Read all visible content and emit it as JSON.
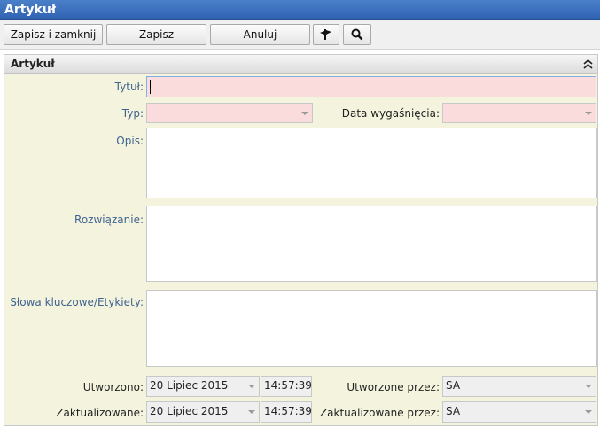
{
  "window": {
    "title": "Artykuł"
  },
  "toolbar": {
    "save_close_label": "Zapisz i zamknij",
    "save_label": "Zapisz",
    "cancel_label": "Anuluj"
  },
  "panel": {
    "title": "Artykuł"
  },
  "form": {
    "title_label": "Tytuł:",
    "title_value": "",
    "type_label": "Typ:",
    "type_value": "",
    "expiry_label": "Data wygaśnięcia:",
    "expiry_value": "",
    "description_label": "Opis:",
    "description_value": "",
    "solution_label": "Rozwiązanie:",
    "solution_value": "",
    "keywords_label": "Słowa kluczowe/Etykiety:",
    "keywords_value": "",
    "created_label": "Utworzono:",
    "created_date": "20 Lipiec 2015",
    "created_time": "14:57:39",
    "created_by_label": "Utworzone przez:",
    "created_by": "SA",
    "updated_label": "Zaktualizowane:",
    "updated_date": "20 Lipiec 2015",
    "updated_time": "14:57:39",
    "updated_by_label": "Zaktualizowane przez:",
    "updated_by": "SA"
  },
  "colors": {
    "titlebar": "#2f63b2",
    "required_field": "#fbdcdc",
    "panel_bg": "#f4f4de",
    "label_blue": "#3f6290"
  },
  "icons": [
    "flag-icon",
    "search-icon",
    "collapse-up-icon",
    "dropdown-arrow-icon"
  ]
}
